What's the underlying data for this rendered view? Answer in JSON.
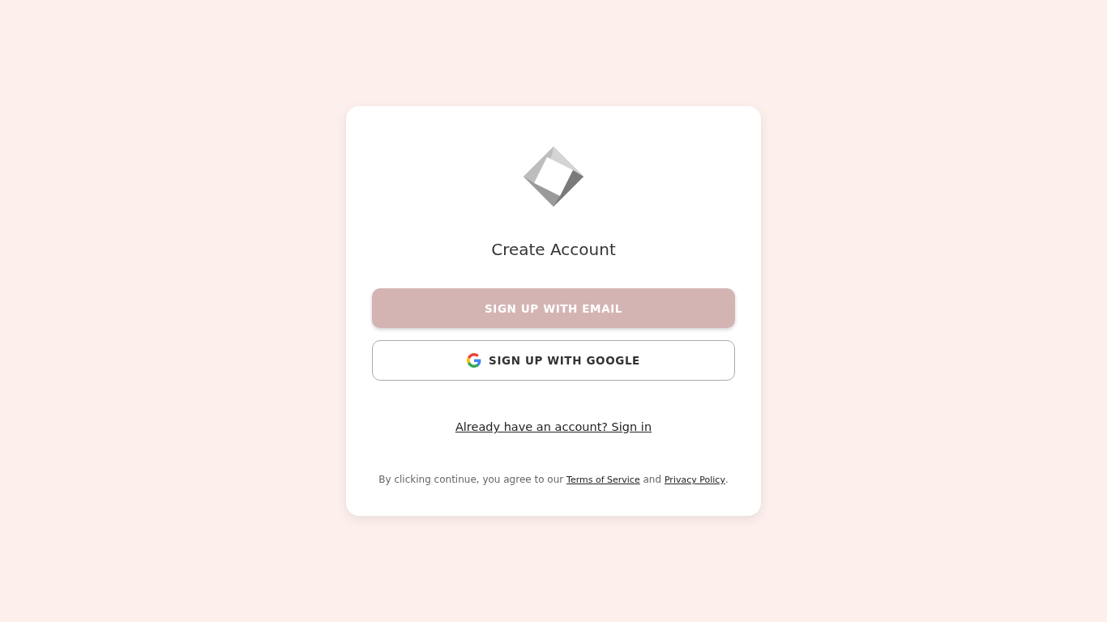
{
  "card": {
    "title": "Create Account",
    "buttons": [
      {
        "kind": "email",
        "label": "SIGN UP WITH EMAIL"
      },
      {
        "kind": "google",
        "label": "SIGN UP WITH GOOGLE"
      }
    ],
    "signin_link": "Already have an account? Sign in",
    "legal": [
      {
        "kind": "text",
        "text": "By clicking continue, you agree to our "
      },
      {
        "kind": "link",
        "text": "Terms of Service"
      },
      {
        "kind": "text",
        "text": " and "
      },
      {
        "kind": "link",
        "text": "Privacy Policy"
      },
      {
        "kind": "text",
        "text": "."
      }
    ]
  }
}
